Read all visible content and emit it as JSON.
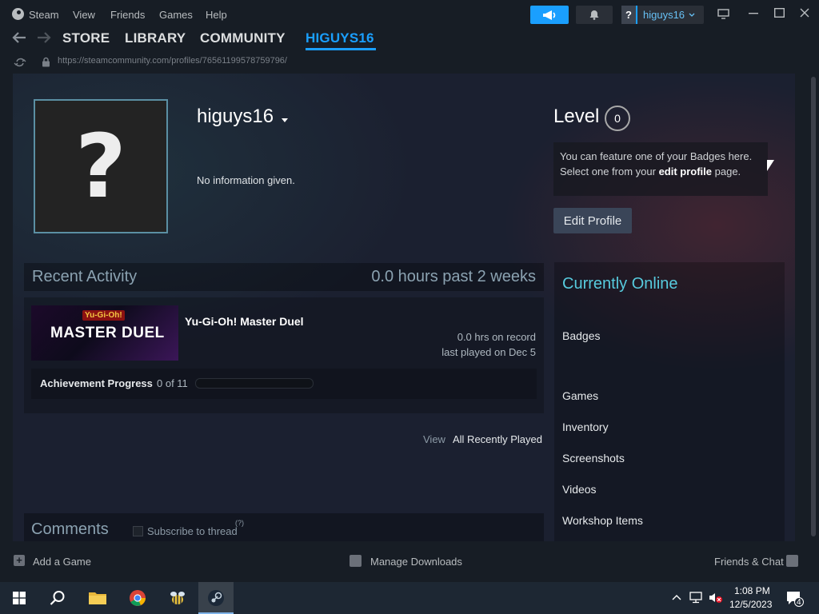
{
  "titlebar": {
    "app_name": "Steam",
    "menu": [
      "View",
      "Friends",
      "Games",
      "Help"
    ],
    "account_badge": "?",
    "account_name": "higuys16"
  },
  "nav": {
    "store": "STORE",
    "library": "LIBRARY",
    "community": "COMMUNITY",
    "user": "HIGUYS16"
  },
  "url": "https://steamcommunity.com/profiles/76561199578759796/",
  "profile": {
    "avatar_glyph": "?",
    "persona_name": "higuys16",
    "summary": "No information given.",
    "level_label": "Level",
    "level_value": "0",
    "badge_text_1": "You can feature one of your Badges here.",
    "badge_text_2_pre": "Select one from your ",
    "badge_text_2_link": "edit profile",
    "badge_text_2_post": " page.",
    "edit_profile": "Edit Profile"
  },
  "activity": {
    "title": "Recent Activity",
    "hours": "0.0 hours past 2 weeks",
    "game": {
      "name": "Yu-Gi-Oh! Master Duel",
      "capsule_logo": "MASTER DUEL",
      "capsule_badge": "Yu-Gi-Oh!",
      "hrs_on_record": "0.0 hrs on record",
      "last_played": "last played on Dec 5",
      "achievement_label": "Achievement Progress",
      "achievement_count": "0 of 11",
      "achievement_progress": 0
    },
    "view_label": "View",
    "view_all": "All Recently Played"
  },
  "comments": {
    "title": "Comments",
    "subscribe": "Subscribe to thread",
    "help": "(?)"
  },
  "sidebar": {
    "status": "Currently Online",
    "links": [
      "Badges",
      "Games",
      "Inventory",
      "Screenshots",
      "Videos",
      "Workshop Items"
    ]
  },
  "bottombar": {
    "add_game": "Add a Game",
    "manage_downloads": "Manage Downloads",
    "friends_chat": "Friends & Chat"
  },
  "taskbar": {
    "time": "1:08 PM",
    "date": "12/5/2023",
    "notification_count": "4"
  },
  "colors": {
    "accent": "#1a9fff",
    "online": "#57cbde",
    "background": "#1b2030"
  }
}
